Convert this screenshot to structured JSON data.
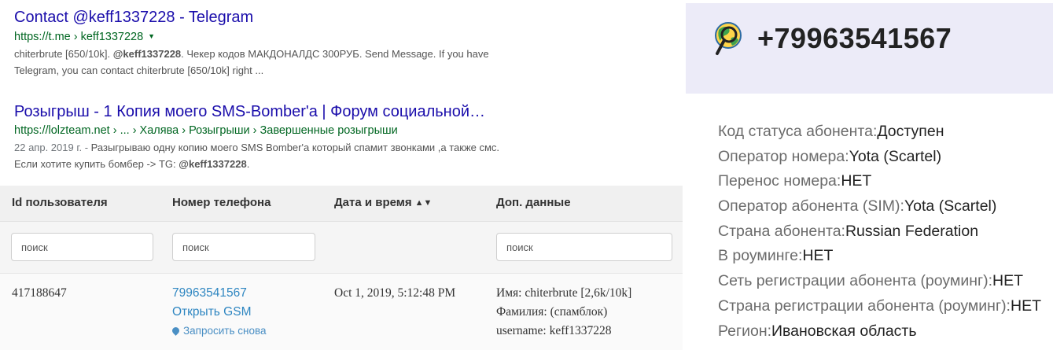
{
  "results": [
    {
      "title": "Contact @keff1337228 - Telegram",
      "url": "https://t.me › keff1337228",
      "dropdown_icon": "caret-down-icon",
      "snippet_pre": "chiterbrute [650/10k]. ",
      "snippet_bold": "@keff1337228",
      "snippet_post": ". Чекер кодов МАКДОНАЛДС 300РУБ. Send Message. If you have Telegram, you can contact chiterbrute [650/10k] right ..."
    },
    {
      "title": "Розыгрыш - 1 Копия моего SMS-Bomber'a | Форум социальной…",
      "url": "https://lolzteam.net › ... › Халява › Розыгрыши › Завершенные розыгрыши",
      "date": "22 апр. 2019 г. - ",
      "snippet_pre": "Разыгрываю одну копию моего SMS Bomber'a который спамит звонками ,а также смс. Если хотите купить бомбер -> TG: ",
      "snippet_bold": "@keff1337228",
      "snippet_post": "."
    }
  ],
  "table": {
    "headers": [
      "Id пользователя",
      "Номер телефона",
      "Дата и время",
      "Доп. данные"
    ],
    "sort_icon": "sort-updown-icon",
    "search_placeholder": "поиск",
    "row": {
      "id": "417188647",
      "phone": "79963541567",
      "open_gsm": "Открыть GSM",
      "request_again": "Запросить снова",
      "datetime": "Oct 1, 2019, 5:12:48 PM",
      "extra": [
        "Имя: chiterbrute [2,6k/10k]",
        "Фамилия: (спамблок)",
        "username: keff1337228"
      ]
    }
  },
  "panel": {
    "phone": "+79963541567",
    "icon": "globe-search-icon",
    "fields": [
      {
        "label": "Код статуса абонента:",
        "value": "Доступен"
      },
      {
        "label": "Оператор номера:",
        "value": "Yota (Scartel)"
      },
      {
        "label": "Перенос номера:",
        "value": "НЕТ"
      },
      {
        "label": "Оператор абонента (SIM):",
        "value": "Yota (Scartel)"
      },
      {
        "label": "Страна абонента:",
        "value": "Russian Federation"
      },
      {
        "label": "В роуминге:",
        "value": "НЕТ"
      },
      {
        "label": "Сеть регистрации абонента (роуминг):",
        "value": "НЕТ"
      },
      {
        "label": "Страна регистрации абонента (роуминг):",
        "value": "НЕТ"
      },
      {
        "label": "Регион:",
        "value": "Ивановская область"
      }
    ]
  },
  "colors": {
    "link_title": "#1a0dab",
    "link_url": "#006621",
    "panel_bg": "#ecebf8",
    "table_link": "#2e86c1"
  }
}
